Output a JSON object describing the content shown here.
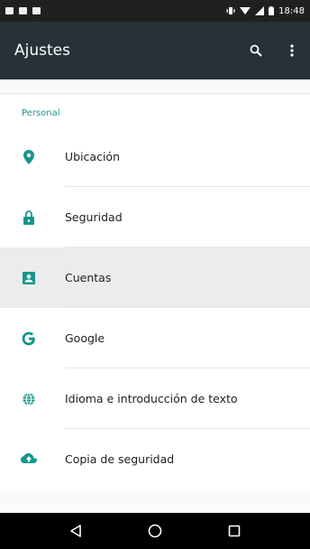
{
  "status_bar": {
    "time": "18:48"
  },
  "app_bar": {
    "title": "Ajustes",
    "search_icon": "search-icon",
    "overflow_icon": "more-vert-icon"
  },
  "accent_color": "#16968b",
  "section": {
    "title": "Personal"
  },
  "items": [
    {
      "label": "Ubicación",
      "icon": "location-pin-icon"
    },
    {
      "label": "Seguridad",
      "icon": "lock-icon"
    },
    {
      "label": "Cuentas",
      "icon": "account-box-icon",
      "selected": true
    },
    {
      "label": "Google",
      "icon": "google-g-icon"
    },
    {
      "label": "Idioma e introducción de texto",
      "icon": "globe-icon"
    },
    {
      "label": "Copia de seguridad",
      "icon": "cloud-upload-icon"
    }
  ],
  "nav_bar": {
    "back_icon": "back-triangle-icon",
    "home_icon": "home-circle-icon",
    "recents_icon": "recents-square-icon"
  }
}
